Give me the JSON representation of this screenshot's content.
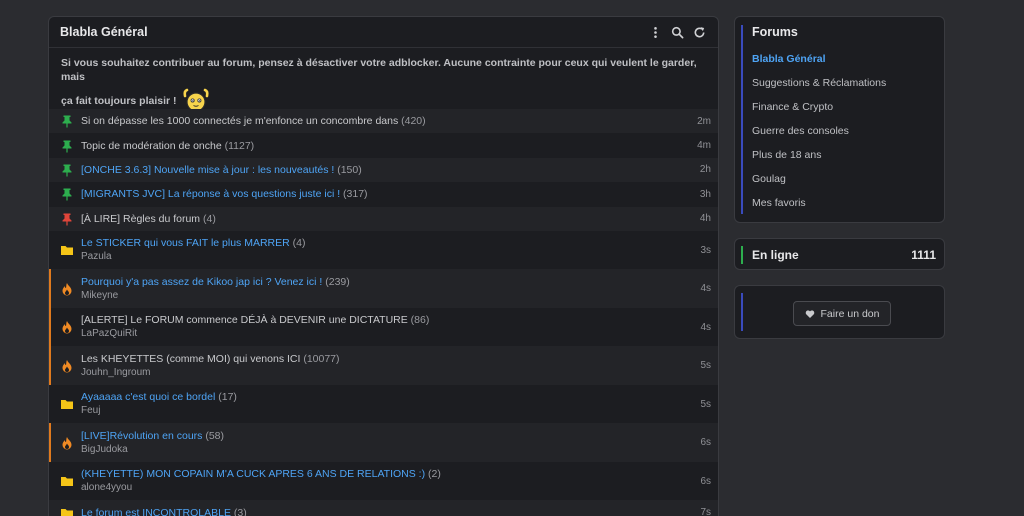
{
  "main": {
    "title": "Blabla Général",
    "notice_line1": "Si vous souhaitez contribuer au forum, pensez à désactiver votre adblocker. Aucune contrainte pour ceux qui veulent le garder, mais",
    "notice_line2": "ça fait toujours plaisir !"
  },
  "topics": [
    {
      "icon": "pin-green-icon",
      "title": "Si on dépasse les 1000 connectés je m'enfonce un concombre dans",
      "count": "(420)",
      "time": "2m",
      "blue": false,
      "author": "",
      "hot": false
    },
    {
      "icon": "pin-green-icon",
      "title": "Topic de modération de onche",
      "count": "(1127)",
      "time": "4m",
      "blue": false,
      "author": "",
      "hot": false
    },
    {
      "icon": "pin-green-icon",
      "title": "[ONCHE 3.6.3] Nouvelle mise à jour : les nouveautés !",
      "count": "(150)",
      "time": "2h",
      "blue": true,
      "author": "",
      "hot": false
    },
    {
      "icon": "pin-green-icon",
      "title": "[MIGRANTS JVC] La réponse à vos questions juste ici !",
      "count": "(317)",
      "time": "3h",
      "blue": true,
      "author": "",
      "hot": false
    },
    {
      "icon": "pin-red-icon",
      "title": "[À LIRE] Règles du forum",
      "count": "(4)",
      "time": "4h",
      "blue": false,
      "author": "",
      "hot": false
    },
    {
      "icon": "folder-icon",
      "title": "Le STICKER qui vous FAIT le plus MARRER",
      "count": "(4)",
      "time": "3s",
      "blue": true,
      "author": "Pazula",
      "hot": false
    },
    {
      "icon": "fire-icon",
      "title": "Pourquoi y'a pas assez de Kikoo jap ici ? Venez ici !",
      "count": "(239)",
      "time": "4s",
      "blue": true,
      "author": "Mikeyne",
      "hot": true
    },
    {
      "icon": "fire-icon",
      "title": "[ALERTE] Le FORUM commence DÉJÀ à DEVENIR une DICTATURE",
      "count": "(86)",
      "time": "4s",
      "blue": false,
      "author": "LaPazQuiRit",
      "hot": true
    },
    {
      "icon": "fire-icon",
      "title": "Les KHEYETTES (comme MOI) qui venons ICI",
      "count": "(10077)",
      "time": "5s",
      "blue": false,
      "author": "Jouhn_Ingroum",
      "hot": true
    },
    {
      "icon": "folder-icon",
      "title": "Ayaaaaa c'est quoi ce bordel",
      "count": "(17)",
      "time": "5s",
      "blue": true,
      "author": "Feuj",
      "hot": false
    },
    {
      "icon": "fire-icon",
      "title": "[LIVE]Révolution en cours",
      "count": "(58)",
      "time": "6s",
      "blue": true,
      "author": "BigJudoka",
      "hot": true
    },
    {
      "icon": "folder-icon",
      "title": "(KHEYETTE) MON COPAIN M'A CUCK APRES 6 ANS DE RELATIONS :)",
      "count": "(2)",
      "time": "6s",
      "blue": true,
      "author": "alone4yyou",
      "hot": false
    },
    {
      "icon": "folder-icon",
      "title": "Le forum est INCONTROLABLE",
      "count": "(3)",
      "time": "7s",
      "blue": true,
      "author": "",
      "hot": false
    }
  ],
  "sidebar": {
    "forums_title": "Forums",
    "forums": [
      {
        "label": "Blabla Général",
        "active": true
      },
      {
        "label": "Suggestions & Réclamations",
        "active": false
      },
      {
        "label": "Finance & Crypto",
        "active": false
      },
      {
        "label": "Guerre des consoles",
        "active": false
      },
      {
        "label": "Plus de 18 ans",
        "active": false
      },
      {
        "label": "Goulag",
        "active": false
      },
      {
        "label": "Mes favoris",
        "active": false
      }
    ],
    "online_label": "En ligne",
    "online_count": "1111",
    "donate_label": "Faire un don"
  },
  "colors": {
    "background": "#2b2c30",
    "panel": "#1c1d21",
    "link_blue": "#4ea4f5",
    "pin_green": "#2dae4e",
    "pin_red": "#e0453a",
    "folder_yellow": "#f5c518",
    "fire_orange": "#f08a24",
    "hot_border": "#e07a1e"
  }
}
